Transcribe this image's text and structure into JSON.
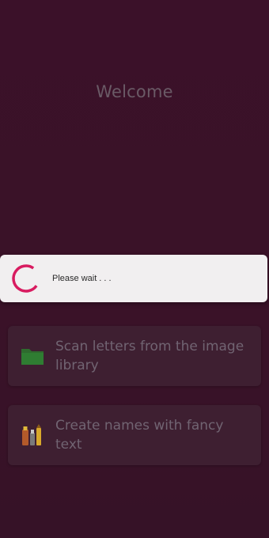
{
  "welcome_text": "Welcome",
  "cards": [
    {
      "label": "Scan letters from the image library",
      "icon": "folder-icon"
    },
    {
      "label": "Create names with fancy text",
      "icon": "pens-icon"
    }
  ],
  "dialog": {
    "message": "Please wait . . .",
    "spinner_color": "#d81b60"
  },
  "colors": {
    "background": "#3a1228",
    "card": "#3e1f31",
    "text_muted": "#6a5a66",
    "folder_green": "#2e7d32"
  }
}
